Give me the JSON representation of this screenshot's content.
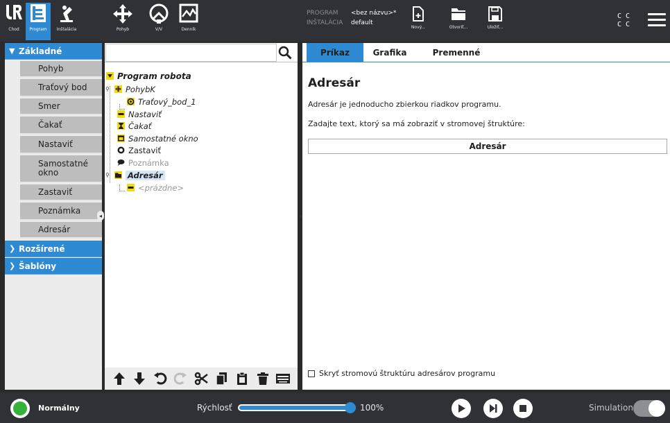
{
  "header": {
    "nav": [
      {
        "label": "Chod",
        "icon": "ur-logo-icon"
      },
      {
        "label": "Program",
        "icon": "program-icon",
        "active": true
      },
      {
        "label": "Inštalácia",
        "icon": "installation-icon"
      },
      {
        "label": "Pohyb",
        "icon": "move-icon"
      },
      {
        "label": "V/V",
        "icon": "io-icon"
      },
      {
        "label": "Denník",
        "icon": "log-icon"
      }
    ],
    "program_key": "PROGRAM",
    "program_value": "<bez názvu>*",
    "installation_key": "INŠTALÁCIA",
    "installation_value": "default",
    "file_buttons": [
      {
        "label": "Nový...",
        "icon": "new-file-icon"
      },
      {
        "label": "Otvoriť...",
        "icon": "open-folder-icon"
      },
      {
        "label": "Uložiť...",
        "icon": "save-icon"
      }
    ],
    "cc_top": "C C",
    "cc_bottom": "C C"
  },
  "sidebar": {
    "sections": [
      {
        "label": "Základné",
        "expanded": true
      },
      {
        "label": "Rozšírené",
        "expanded": false
      },
      {
        "label": "Šablóny",
        "expanded": false
      }
    ],
    "items": [
      {
        "label": "Pohyb"
      },
      {
        "label": "Traťový bod"
      },
      {
        "label": "Smer"
      },
      {
        "label": "Čakať"
      },
      {
        "label": "Nastaviť"
      },
      {
        "label": "Samostatné okno"
      },
      {
        "label": "Zastaviť"
      },
      {
        "label": "Poznámka"
      },
      {
        "label": "Adresár"
      }
    ]
  },
  "tree": {
    "search_value": "",
    "nodes": [
      {
        "label": "Program robota",
        "icon": "triangle-down-icon"
      },
      {
        "label": "PohybK",
        "icon": "move-cross-icon"
      },
      {
        "label": "Traťový_bod_1",
        "icon": "waypoint-icon"
      },
      {
        "label": "Nastaviť",
        "icon": "set-icon"
      },
      {
        "label": "Čakať",
        "icon": "hourglass-icon"
      },
      {
        "label": "Samostatné okno",
        "icon": "popup-icon"
      },
      {
        "label": "Zastaviť",
        "icon": "stop-hand-icon"
      },
      {
        "label": "Poznámka",
        "icon": "comment-icon"
      },
      {
        "label": "Adresár",
        "icon": "folder-icon"
      },
      {
        "label": "<prázdne>",
        "icon": "empty-icon"
      }
    ]
  },
  "tabs": [
    {
      "label": "Príkaz",
      "active": true
    },
    {
      "label": "Grafika"
    },
    {
      "label": "Premenné"
    }
  ],
  "right": {
    "title": "Adresár",
    "description": "Adresár je jednoducho zbierkou riadkov programu.",
    "instruction": "Zadajte text, ktorý sa má zobraziť v stromovej štruktúre:",
    "input_value": "Adresár",
    "hide_tree_label": "Skryť stromovú štruktúru adresárov programu"
  },
  "footer": {
    "status": "Normálny",
    "speed_label": "Rýchlosť",
    "speed_value": "100%",
    "speed_fraction": 1.0,
    "simulation_label": "Simulation"
  },
  "colors": {
    "accent": "#2f8ad4",
    "header_bg": "#2f3137",
    "status_green": "#35b23a"
  }
}
